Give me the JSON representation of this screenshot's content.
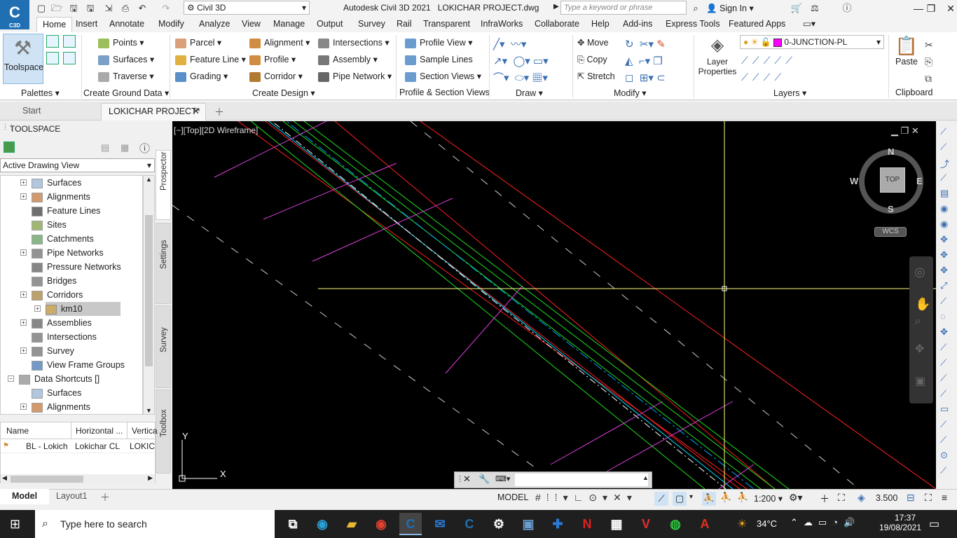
{
  "app": {
    "title": "Autodesk Civil 3D 2021",
    "document": "LOKICHAR PROJECT.dwg",
    "logo": "C",
    "logo_sub": "C3D",
    "workspace": "Civil 3D",
    "search_placeholder": "Type a keyword or phrase",
    "sign_in": "Sign In"
  },
  "menu_tabs": [
    "Home",
    "Insert",
    "Annotate",
    "Modify",
    "Analyze",
    "View",
    "Manage",
    "Output",
    "Survey",
    "Rail",
    "Transparent",
    "InfraWorks",
    "Collaborate",
    "Help",
    "Add-ins",
    "Express Tools",
    "Featured Apps"
  ],
  "ribbon": {
    "toolspace": "Toolspace",
    "palettes": "Palettes",
    "ground": {
      "points": "Points",
      "surfaces": "Surfaces",
      "traverse": "Traverse",
      "title": "Create Ground Data"
    },
    "design": {
      "parcel": "Parcel",
      "feature_line": "Feature Line",
      "grading": "Grading",
      "alignment": "Alignment",
      "profile": "Profile",
      "corridor": "Corridor",
      "intersections": "Intersections",
      "assembly": "Assembly",
      "pipe_network": "Pipe Network",
      "title": "Create Design"
    },
    "profile_section": {
      "profile_view": "Profile View",
      "sample_lines": "Sample Lines",
      "section_views": "Section Views",
      "title": "Profile & Section Views"
    },
    "draw": {
      "title": "Draw"
    },
    "modify": {
      "move": "Move",
      "copy": "Copy",
      "stretch": "Stretch",
      "title": "Modify"
    },
    "layers": {
      "layer_properties": "Layer Properties",
      "current_layer": "0-JUNCTION-PL",
      "title": "Layers"
    },
    "clipboard": {
      "paste": "Paste",
      "title": "Clipboard"
    }
  },
  "doc_tabs": {
    "start": "Start",
    "active": "LOKICHAR PROJECT*"
  },
  "toolspace": {
    "title": "TOOLSPACE",
    "view_dropdown": "Active Drawing View",
    "tree": [
      {
        "label": "Surfaces",
        "indent": 1,
        "expand": true
      },
      {
        "label": "Alignments",
        "indent": 1,
        "expand": true
      },
      {
        "label": "Feature Lines",
        "indent": 1,
        "expand": false
      },
      {
        "label": "Sites",
        "indent": 1,
        "expand": false
      },
      {
        "label": "Catchments",
        "indent": 1,
        "expand": false
      },
      {
        "label": "Pipe Networks",
        "indent": 1,
        "expand": true
      },
      {
        "label": "Pressure Networks",
        "indent": 1,
        "expand": false
      },
      {
        "label": "Bridges",
        "indent": 1,
        "expand": false
      },
      {
        "label": "Corridors",
        "indent": 1,
        "expand": true
      },
      {
        "label": "km10",
        "indent": 2,
        "expand": true,
        "selected": true
      },
      {
        "label": "Assemblies",
        "indent": 1,
        "expand": true
      },
      {
        "label": "Intersections",
        "indent": 1,
        "expand": false
      },
      {
        "label": "Survey",
        "indent": 1,
        "expand": true
      },
      {
        "label": "View Frame Groups",
        "indent": 1,
        "expand": false
      },
      {
        "label": "Data Shortcuts []",
        "indent": 0,
        "expand": true
      },
      {
        "label": "Surfaces",
        "indent": 1,
        "expand": false
      },
      {
        "label": "Alignments",
        "indent": 1,
        "expand": true
      }
    ],
    "vertical_tabs": [
      "Prospector",
      "Settings",
      "Survey",
      "Toolbox"
    ],
    "grid": {
      "headers": [
        "Name",
        "Horizontal ...",
        "Vertica"
      ],
      "rows": [
        [
          "BL - Lokich",
          "Lokichar CL",
          "LOKICH"
        ]
      ]
    }
  },
  "viewport": {
    "label": "[−][Top][2D Wireframe]",
    "compass": {
      "n": "N",
      "s": "S",
      "e": "E",
      "w": "W",
      "top": "TOP",
      "wcs": "WCS"
    },
    "axis_y": "Y",
    "axis_x": "X"
  },
  "status": {
    "model_tab": "Model",
    "layout_tab": "Layout1",
    "model": "MODEL",
    "scale": "1:200",
    "value": "3.500"
  },
  "taskbar": {
    "search": "Type here to search",
    "temperature": "34°C",
    "time": "17:37",
    "date": "19/08/2021"
  },
  "colors": {
    "accent": "#1f6fb2",
    "layer_swatch": "#ff00ff"
  }
}
